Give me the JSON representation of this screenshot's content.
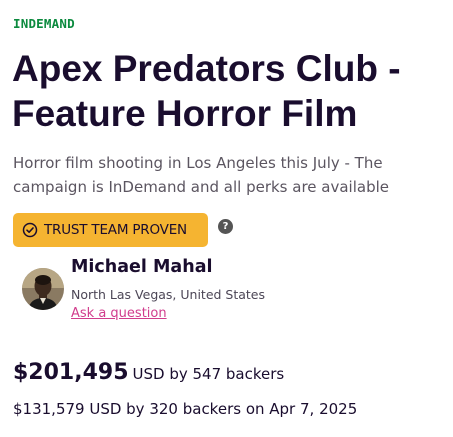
{
  "campaign": {
    "status_tag": "INDEMAND",
    "title": "Apex Predators Club - Feature Horror Film",
    "blurb": "Horror film shooting in Los Angeles this July - The campaign is InDemand and all perks are available"
  },
  "badge": {
    "label": "TRUST TEAM PROVEN",
    "icon": "check-circle-icon",
    "color": "#f5b431"
  },
  "help": {
    "icon": "question-mark-icon",
    "glyph": "?"
  },
  "owner": {
    "name": "Michael Mahal",
    "location": "North Las Vegas, United States",
    "ask_link": "Ask a question"
  },
  "funding": {
    "amount": "$201,495",
    "suffix": "USD by 547 backers",
    "secondary": "$131,579 USD by 320 backers on Apr 7, 2025"
  },
  "colors": {
    "status_green": "#0b8a3e",
    "link_pink": "#d13c8c",
    "text_dark": "#1a0d2e"
  }
}
